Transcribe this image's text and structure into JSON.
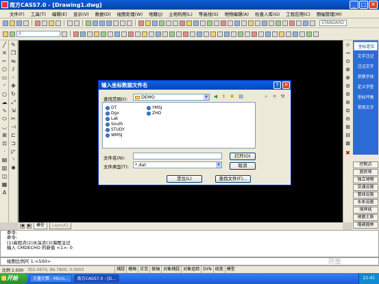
{
  "window": {
    "title": "南方CASS7.0 - [Drawing1.dwg]"
  },
  "menu": [
    "文件(F)",
    "工具(T)",
    "编辑(E)",
    "显示(V)",
    "数据(D)",
    "绘图处理(W)",
    "地籍(J)",
    "土地利用(L)",
    "等高线(S)",
    "地物编辑(A)",
    "检查入库(G)",
    "工程应用(C)",
    "图幅管理(M)"
  ],
  "toolbar": {
    "layer_combo": "0",
    "standard_label": "STANDARD"
  },
  "right_panel": {
    "top_items": [
      "坐标定位",
      "文字注记",
      "注记文字",
      "变换字体",
      "定义字型",
      "坐标坪高",
      "常用文字"
    ],
    "bottom_items": [
      "控制点",
      "居民地",
      "独立地物",
      "交通设施",
      "管线设施",
      "水系设施",
      "境界线",
      "地貌土质",
      "植被园林"
    ]
  },
  "tabs": {
    "model": "模型",
    "layout": "Layout1"
  },
  "command": {
    "lines": [
      "命令:",
      "命令:",
      "(1)高程点(2)水深点(3)海图注记",
      "输入 CMDECHO 的新值 <1>: 0"
    ],
    "prompt": "绘图比例尺 1:<500>"
  },
  "status": {
    "scale": "比例 1:500",
    "coords": "302.0670, 86.7800, 0.0000",
    "items": [
      "捕捉",
      "栅格",
      "正交",
      "极轴",
      "对象捕捉",
      "对象追踪",
      "DYN",
      "线宽",
      "模型"
    ]
  },
  "taskbar": {
    "start": "开始",
    "tasks": [
      "方量计算 - Micro...",
      "南方CASS7.0 - [D..."
    ],
    "clock": "21:41"
  },
  "watermark": "测量",
  "dialog": {
    "title": "输入坐标数据文件名",
    "lookin_label": "查找范围(I):",
    "lookin_value": "DEMO",
    "files": [
      "DT",
      "Dgx",
      "Lak",
      "South",
      "STUDY",
      "WMSJ",
      "YMSJ",
      "ZHD"
    ],
    "filename_label": "文件名(N):",
    "filename_value": "",
    "filetype_label": "文件类型(T):",
    "filetype_value": "*.dat",
    "open_button": "打开(O)",
    "cancel_button": "取消",
    "locate_button": "定位(L)",
    "find_button": "查找文件(F)...",
    "tools_label": "工具(L)"
  }
}
